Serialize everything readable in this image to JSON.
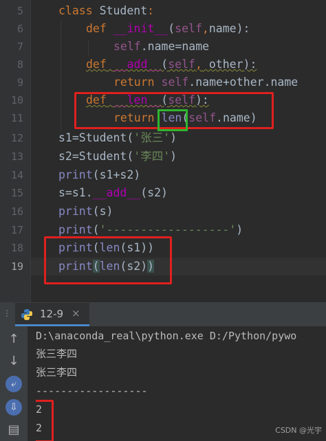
{
  "editor": {
    "lines": [
      {
        "num": "5"
      },
      {
        "num": "6"
      },
      {
        "num": "7"
      },
      {
        "num": "8"
      },
      {
        "num": "9"
      },
      {
        "num": "10"
      },
      {
        "num": "11"
      },
      {
        "num": "12"
      },
      {
        "num": "13"
      },
      {
        "num": "14"
      },
      {
        "num": "15"
      },
      {
        "num": "16"
      },
      {
        "num": "17"
      },
      {
        "num": "18"
      },
      {
        "num": "19"
      }
    ],
    "tokens": {
      "l5_class": "class",
      "l5_name": "Student",
      "l5_colon": ":",
      "l6_def": "def",
      "l6_fn": "__init__",
      "l6_open": "(",
      "l6_self": "self",
      "l6_comma": ",",
      "l6_param": "name",
      "l6_close": "):",
      "l7_self": "self",
      "l7_rest": ".name=name",
      "l8_def": "def",
      "l8_fn": "__add__",
      "l8_open": "(",
      "l8_self": "self",
      "l8_comma": ",",
      "l8_param": " other",
      "l8_close": "):",
      "l9_return": "return",
      "l9_self": "self",
      "l9_mid": ".name+other.name",
      "l10_def": "def",
      "l10_fn": "__len__",
      "l10_open": "(",
      "l10_self": "self",
      "l10_close": "):",
      "l11_return": "return",
      "l11_len": "len",
      "l11_open": "(",
      "l11_self": "self",
      "l11_rest": ".name)",
      "l12_a": "s1=Student(",
      "l12_str": "'张三'",
      "l12_b": ")",
      "l13_a": "s2=Student(",
      "l13_str": "'李四'",
      "l13_b": ")",
      "l14_print": "print",
      "l14_rest": "(s1+s2)",
      "l15_a": "s=s1.",
      "l15_fn": "__add__",
      "l15_b": "(s2)",
      "l16_print": "print",
      "l16_rest": "(s)",
      "l17_print": "print",
      "l17_open": "(",
      "l17_str": "'------------------'",
      "l17_close": ")",
      "l18_print": "print",
      "l18_open": "(",
      "l18_len": "len",
      "l18_rest": "(s1))",
      "l19_print": "print",
      "l19_open": "(",
      "l19_len": "len",
      "l19_rest": "(s2)",
      "l19_close": ")"
    }
  },
  "run_panel": {
    "tab_label": "12-9",
    "tab_close": "×",
    "console_lines": [
      "D:\\anaconda_real\\python.exe D:/Python/pywo",
      "张三李四",
      "张三李四",
      "------------------",
      "2",
      "2"
    ],
    "watermark": "CSDN @光宇"
  },
  "colors": {
    "highlight_red": "#e0201e",
    "highlight_green": "#2fb52f",
    "editor_bg": "#2b2b2b"
  }
}
